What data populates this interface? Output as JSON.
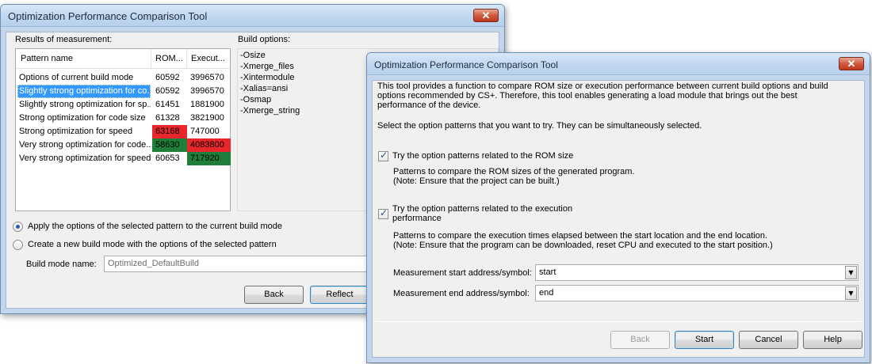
{
  "back_window": {
    "title": "Optimization Performance Comparison Tool",
    "results_label": "Results of measurement:",
    "build_options_label": "Build options:",
    "columns": [
      "Pattern name",
      "ROM...",
      "Execut..."
    ],
    "rows": [
      {
        "name": "Options of current build mode",
        "rom": "60592",
        "exec": "3996570",
        "rom_hl": "",
        "exec_hl": "",
        "selected": false
      },
      {
        "name": "Slightly strong optimization for co...",
        "rom": "60592",
        "exec": "3996570",
        "rom_hl": "",
        "exec_hl": "",
        "selected": true
      },
      {
        "name": "Slightly strong optimization for sp...",
        "rom": "61451",
        "exec": "1881900",
        "rom_hl": "",
        "exec_hl": "",
        "selected": false
      },
      {
        "name": "Strong optimization for code size",
        "rom": "61328",
        "exec": "3821900",
        "rom_hl": "",
        "exec_hl": "",
        "selected": false
      },
      {
        "name": "Strong optimization for speed",
        "rom": "63168",
        "exec": "747000",
        "rom_hl": "red",
        "exec_hl": "",
        "selected": false
      },
      {
        "name": "Very strong optimization for code...",
        "rom": "58630",
        "exec": "4083800",
        "rom_hl": "green",
        "exec_hl": "red",
        "selected": false
      },
      {
        "name": "Very strong optimization for speed",
        "rom": "60653",
        "exec": "717920",
        "rom_hl": "",
        "exec_hl": "green",
        "selected": false
      }
    ],
    "build_options": [
      "-Osize",
      "-Xmerge_files",
      "-Xintermodule",
      "-Xalias=ansi",
      "-Osmap",
      "-Xmerge_string"
    ],
    "radio_apply": "Apply the options of the selected pattern to the current build mode",
    "radio_create": "Create a new build mode with the options of the selected pattern",
    "build_mode_name_label": "Build mode name:",
    "build_mode_name_value": "Optimized_DefaultBuild",
    "back_button": "Back",
    "reflect_button": "Reflect"
  },
  "front_window": {
    "title": "Optimization Performance Comparison Tool",
    "description": [
      "This tool provides a function to compare ROM size or execution performance between current build options and build",
      "options recommended by CS+. Therefore, this tool enables generating a load module that brings out the best",
      "performance of the device."
    ],
    "instruction": "Select the option patterns that you want to try. They can be simultaneously selected.",
    "check_rom_label": "Try the option patterns related to the ROM size",
    "check_rom_checked": true,
    "rom_desc": [
      "Patterns to compare the ROM sizes of the generated program.",
      "(Note: Ensure that the project can be built.)"
    ],
    "check_exec_label": [
      "Try the option patterns related to the execution",
      "performance"
    ],
    "check_exec_checked": true,
    "exec_desc": [
      "Patterns to compare the execution times elapsed between the start location and the end location.",
      "(Note: Ensure that the program can be downloaded, reset CPU and executed to the start position.)"
    ],
    "start_label": "Measurement start address/symbol:",
    "start_value": "start",
    "end_label": "Measurement end address/symbol:",
    "end_value": "end",
    "buttons": {
      "back": "Back",
      "start": "Start",
      "cancel": "Cancel",
      "help": "Help"
    }
  },
  "colors": {
    "highlight_red": "#e8262c",
    "highlight_green": "#1f7f3a",
    "selection": "#3399ff"
  }
}
